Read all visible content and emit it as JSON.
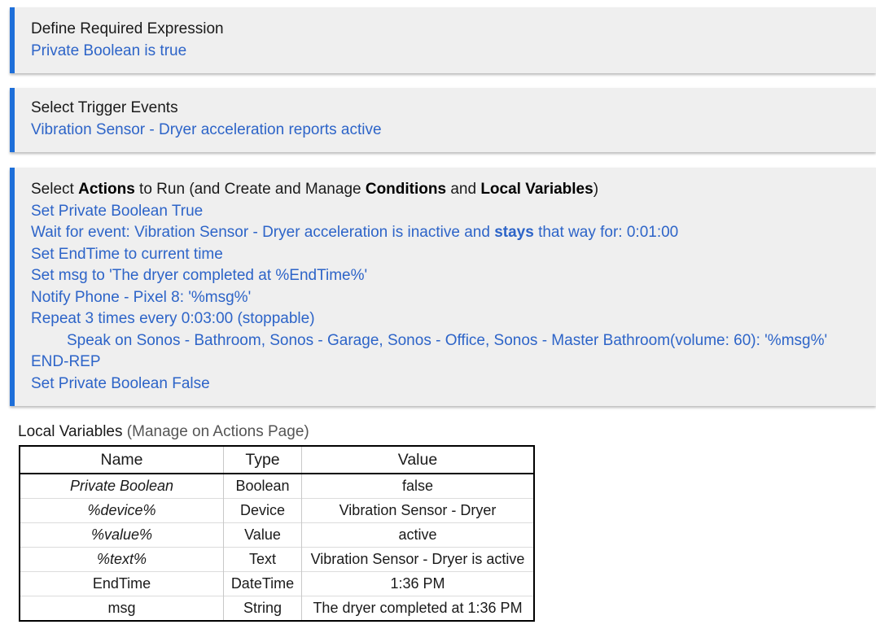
{
  "required_expression": {
    "title": "Define Required Expression",
    "value": "Private Boolean is true"
  },
  "trigger_events": {
    "title": "Select Trigger Events",
    "value": "Vibration Sensor - Dryer acceleration reports active"
  },
  "actions": {
    "title_parts": {
      "p1": "Select ",
      "b1": "Actions",
      "p2": " to Run (and Create and Manage ",
      "b2": "Conditions",
      "p3": " and ",
      "b3": "Local Variables",
      "p4": ")"
    },
    "set_pb_true": "Set Private Boolean True",
    "wait_event": {
      "pre": "Wait for event: Vibration Sensor - Dryer acceleration is inactive and ",
      "bold": "stays",
      "post": " that way for: 0:01:00"
    },
    "set_endtime": "Set EndTime to current time",
    "set_msg": "Set msg to 'The dryer completed at %EndTime%'",
    "notify": "Notify Phone - Pixel 8: '%msg%'",
    "repeat": "Repeat 3 times every 0:03:00 (stoppable)",
    "speak": "Speak on Sonos - Bathroom, Sonos - Garage, Sonos - Office, Sonos - Master Bathroom(volume: 60): '%msg%'",
    "end_rep": "END-REP",
    "set_pb_false": "Set Private Boolean False"
  },
  "local_variables": {
    "heading": "Local Variables",
    "manage_note": " (Manage on Actions Page)",
    "columns": [
      "Name",
      "Type",
      "Value"
    ],
    "rows": [
      [
        "Private Boolean",
        "Boolean",
        "false"
      ],
      [
        "%device%",
        "Device",
        "Vibration Sensor - Dryer"
      ],
      [
        "%value%",
        "Value",
        "active"
      ],
      [
        "%text%",
        "Text",
        "Vibration Sensor - Dryer is active"
      ],
      [
        "EndTime",
        "DateTime",
        "1:36 PM"
      ],
      [
        "msg",
        "String",
        "The dryer completed at 1:36 PM"
      ]
    ]
  },
  "colors": {
    "accent": "#1e6fd9",
    "link": "#2d64c8",
    "panel_bg": "#efefef"
  }
}
